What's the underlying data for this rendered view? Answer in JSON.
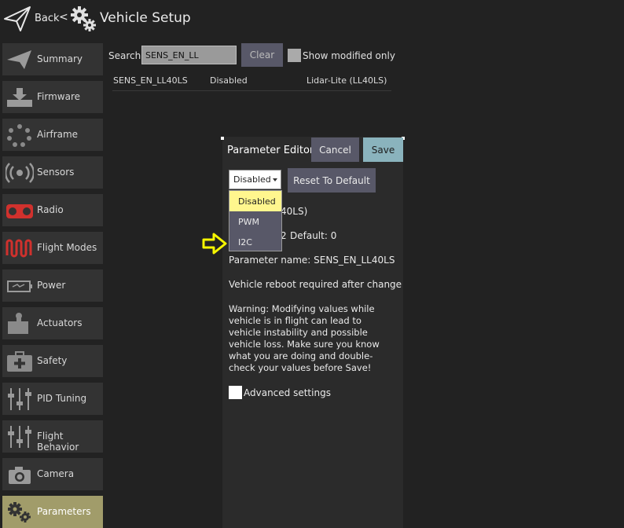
{
  "header": {
    "back_label": "Back",
    "back_separator": "<",
    "title": "Vehicle Setup"
  },
  "sidebar": {
    "items": [
      {
        "label": "Summary",
        "icon": "paper-plane-icon"
      },
      {
        "label": "Firmware",
        "icon": "firmware-download-icon"
      },
      {
        "label": "Airframe",
        "icon": "airframe-icon"
      },
      {
        "label": "Sensors",
        "icon": "sensors-icon"
      },
      {
        "label": "Radio",
        "icon": "radio-icon"
      },
      {
        "label": "Flight Modes",
        "icon": "flight-modes-icon"
      },
      {
        "label": "Power",
        "icon": "battery-icon"
      },
      {
        "label": "Actuators",
        "icon": "actuator-icon"
      },
      {
        "label": "Safety",
        "icon": "medkit-icon"
      },
      {
        "label": "PID Tuning",
        "icon": "sliders-icon"
      },
      {
        "label": "Flight Behavior",
        "icon": "sliders-icon"
      },
      {
        "label": "Camera",
        "icon": "camera-icon"
      },
      {
        "label": "Parameters",
        "icon": "gears-icon",
        "active": true
      }
    ],
    "active_color": "#a19c6a"
  },
  "search": {
    "label": "Search:",
    "value": "SENS_EN_LL",
    "clear_label": "Clear",
    "modified_only_label": "Show modified only"
  },
  "param_row": {
    "name": "SENS_EN_LL40LS",
    "value": "Disabled",
    "description": "Lidar-Lite (LL40LS)"
  },
  "dialog": {
    "title": "Parameter Editor",
    "cancel_label": "Cancel",
    "save_label": "Save",
    "combo_value": "Disabled",
    "reset_label": "Reset To Default",
    "options": [
      "Disabled",
      "PWM",
      "I2C"
    ],
    "selected_option": "Disabled",
    "partial_desc": "40LS)",
    "partial_range": "2",
    "default_text": "Default: 0",
    "param_name_text": "Parameter name: SENS_EN_LL40LS",
    "reboot_text": "Vehicle reboot required after change",
    "warning_text": "Warning: Modifying values while vehicle is in flight can lead to vehicle instability and possible vehicle loss. Make sure you know what you are doing and double-check your values before Save!",
    "advanced_label": "Advanced settings"
  },
  "colors": {
    "background": "#222222",
    "button": "#585868",
    "save_button": "#8ab3bd",
    "highlight": "#fff68e",
    "pointer_arrow": "#f5f500"
  }
}
